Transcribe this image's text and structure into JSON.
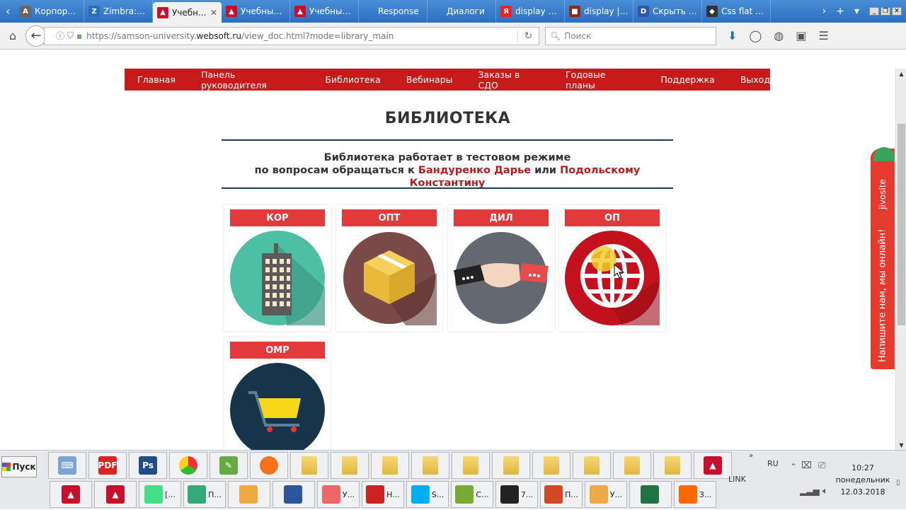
{
  "browser": {
    "tabs": [
      {
        "label": "Корпорат...",
        "fav": "А",
        "color": "#666",
        "active": false
      },
      {
        "label": "Zimbra: Ре...",
        "fav": "Z",
        "color": "#2a6ebb",
        "active": false
      },
      {
        "label": "Учебн...",
        "fav": "▲",
        "color": "#c8102e",
        "active": true
      },
      {
        "label": "Учебный ...",
        "fav": "▲",
        "color": "#c8102e",
        "active": false
      },
      {
        "label": "Учебный ...",
        "fav": "▲",
        "color": "#c8102e",
        "active": false
      },
      {
        "label": "Response",
        "fav": "",
        "color": "transparent",
        "active": false
      },
      {
        "label": "Диалоги",
        "fav": "",
        "color": "transparent",
        "active": false
      },
      {
        "label": "display css...",
        "fav": "Я",
        "color": "#e22",
        "active": false
      },
      {
        "label": "display | h...",
        "fav": "■",
        "color": "#8a2a1a",
        "active": false
      },
      {
        "label": "Скрыть и...",
        "fav": "D",
        "color": "#3355aa",
        "active": false
      },
      {
        "label": "Css flat bu...",
        "fav": "◆",
        "color": "#333",
        "active": false
      }
    ],
    "url_prefix": "https://samson-university.",
    "url_host": "websoft.ru",
    "url_path": "/view_doc.html?mode=library_main",
    "search_placeholder": "Поиск"
  },
  "site": {
    "menu": [
      "Главная",
      "Панель руководителя",
      "Библиотека",
      "Вебинары",
      "Заказы в СДО",
      "Годовые планы",
      "Поддержка",
      "Выход"
    ],
    "title": "БИБЛИОТЕКА",
    "notice_line1": "Библиотека работает в тестовом режиме",
    "notice_prefix": "по вопросам обращаться к ",
    "contact1": "Бандуренко Дарье",
    "notice_mid": " или ",
    "contact2": "Подольскому Константину",
    "cards": [
      {
        "label": "КОР",
        "icon": "building-icon",
        "bg": "#4dbfa5"
      },
      {
        "label": "ОПТ",
        "icon": "box-icon",
        "bg": "#7a4a48"
      },
      {
        "label": "ДИЛ",
        "icon": "handshake-icon",
        "bg": "#646870"
      },
      {
        "label": "ОП",
        "icon": "globe-icon",
        "bg": "#c3121e"
      },
      {
        "label": "ОМР",
        "icon": "cart-icon",
        "bg": "#17344a"
      }
    ]
  },
  "jivo": {
    "brand": "jivosite",
    "text": "Напишите нам, мы онлайн!"
  },
  "taskbar": {
    "start_label": "Пуск",
    "row2": [
      {
        "label": "[...",
        "color": "#4d8"
      },
      {
        "label": "П...",
        "color": "#3a7"
      },
      {
        "label": "",
        "color": "#ea4"
      },
      {
        "label": "",
        "color": "#2b579a"
      },
      {
        "label": "У...",
        "color": "#e66"
      },
      {
        "label": "Н...",
        "color": "#c22"
      },
      {
        "label": "S...",
        "color": "#00aff0"
      },
      {
        "label": "С...",
        "color": "#7a3"
      },
      {
        "label": "7...",
        "color": "#222"
      },
      {
        "label": "П...",
        "color": "#d24726"
      },
      {
        "label": "У...",
        "color": "#ea4"
      },
      {
        "label": "",
        "color": "#217346"
      },
      {
        "label": "З...",
        "color": "#f60"
      }
    ],
    "link_label": "LINK",
    "lang": "RU",
    "time": "10:27",
    "weekday": "понедельник",
    "date": "12.03.2018"
  }
}
